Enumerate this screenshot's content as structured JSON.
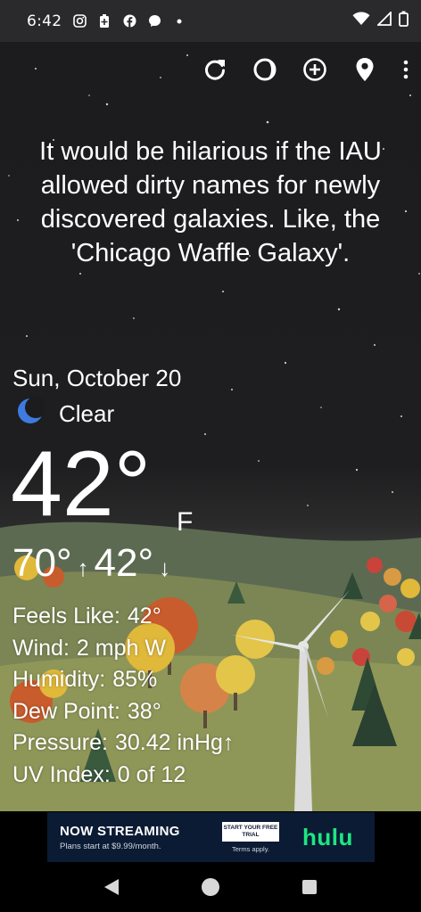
{
  "status_bar": {
    "time": "6:42",
    "left_icons": [
      "instagram-icon",
      "battery-saver-icon",
      "facebook-icon",
      "messenger-icon",
      "dot-icon"
    ],
    "right_icons": [
      "wifi-icon",
      "signal-icon",
      "battery-icon"
    ]
  },
  "toolbar": {
    "icons": [
      "refresh-icon",
      "theme-toggle-icon",
      "add-location-icon",
      "location-pin-icon",
      "overflow-menu-icon"
    ]
  },
  "quote": "It would be hilarious if the IAU allowed dirty names for newly discovered galaxies. Like, the 'Chicago Waffle Galaxy'.",
  "weather": {
    "date": "Sun, October 20",
    "condition": "Clear",
    "condition_icon": "moon-icon",
    "temperature": "42°",
    "unit": "F",
    "high": "70°",
    "high_arrow": "↑",
    "low": "42°",
    "low_arrow": "↓",
    "details": [
      {
        "label": "Feels Like:",
        "value": "42°"
      },
      {
        "label": "Wind:",
        "value": "2 mph W"
      },
      {
        "label": "Humidity:",
        "value": "85%"
      },
      {
        "label": "Dew Point:",
        "value": "38°"
      },
      {
        "label": "Pressure:",
        "value": "30.42 inHg↑"
      },
      {
        "label": "UV Index:",
        "value": "0 of 12"
      }
    ]
  },
  "ad": {
    "headline": "NOW STREAMING",
    "subline": "Plans start at $9.99/month.",
    "cta": "START YOUR FREE TRIAL",
    "terms": "Terms apply.",
    "brand": "hulu",
    "brand_color": "#1ce783"
  },
  "nav": {
    "icons": [
      "back-icon",
      "home-icon",
      "recents-icon"
    ]
  }
}
